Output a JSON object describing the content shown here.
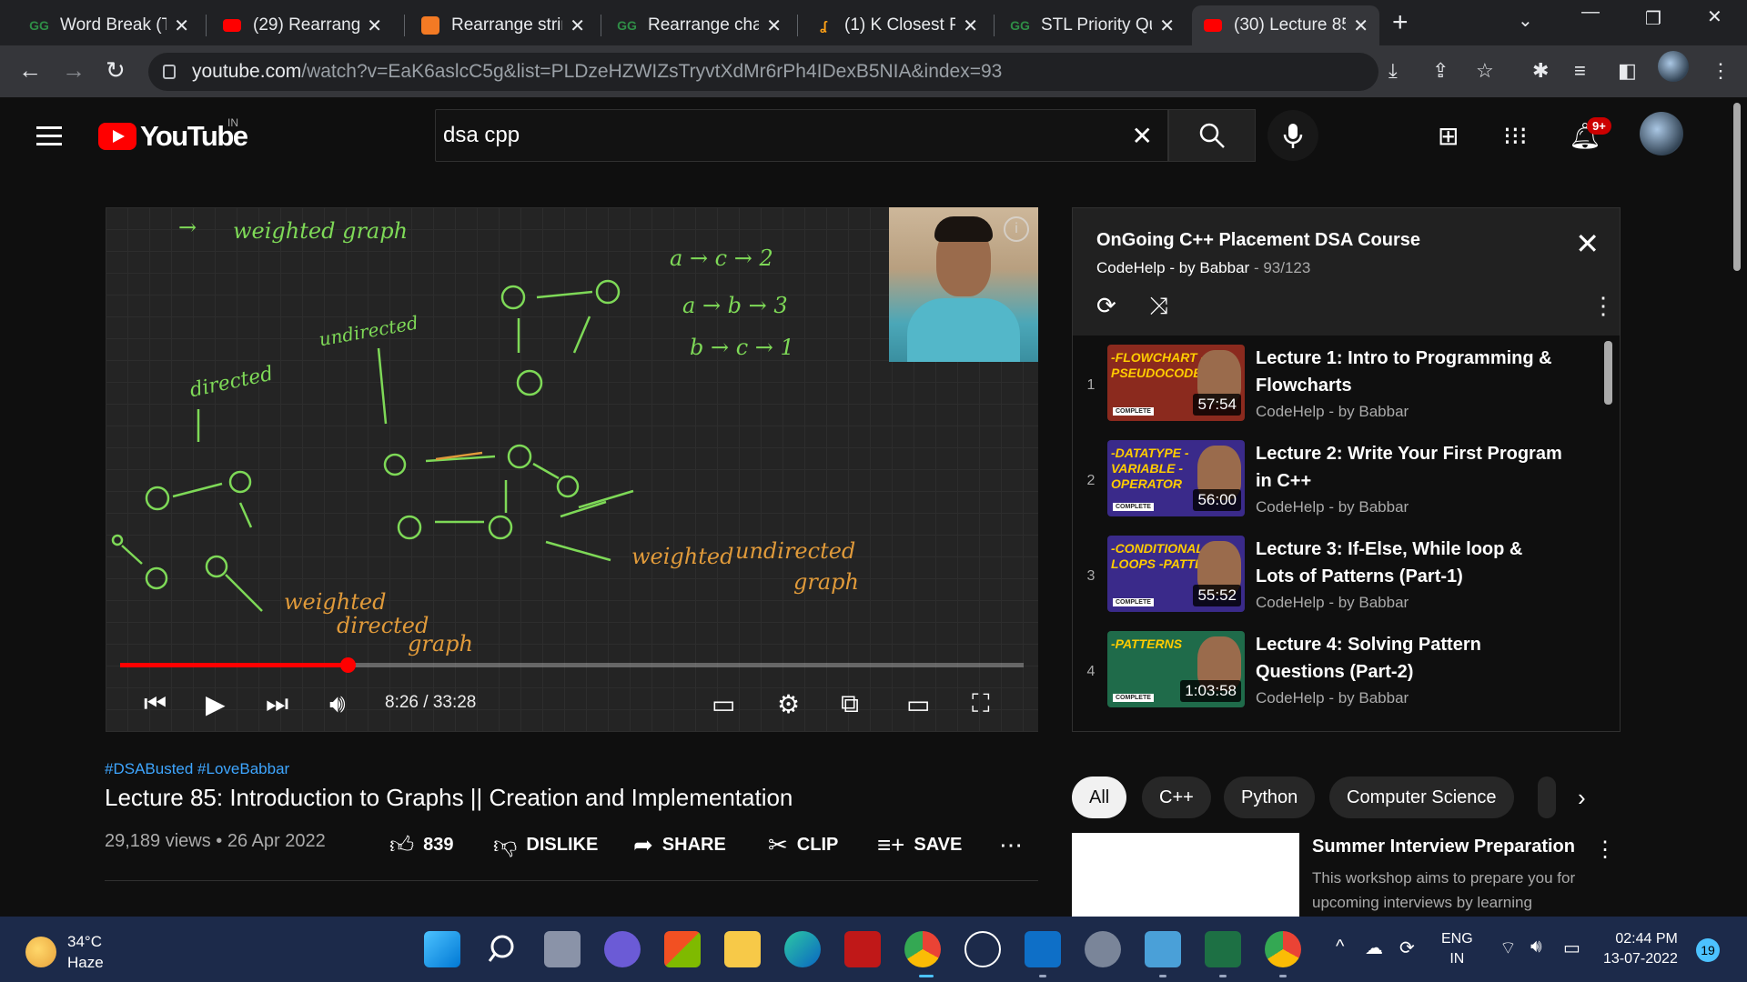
{
  "tabs": [
    {
      "title": "Word Break (Tri",
      "fav": "gfg"
    },
    {
      "title": "(29) Rearrange",
      "fav": "yt"
    },
    {
      "title": "Rearrange strin",
      "fav": "cn"
    },
    {
      "title": "Rearrange char",
      "fav": "gfg"
    },
    {
      "title": "(1) K Closest Pc",
      "fav": "lc"
    },
    {
      "title": "STL Priority Qu",
      "fav": "gfg"
    },
    {
      "title": "(30) Lecture 85",
      "fav": "yt"
    }
  ],
  "url": {
    "host": "youtube.com",
    "path": "/watch?v=EaK6aslcC5g&list=PLDzeHZWIZsTryvtXdMr6rPh4IDexB5NIA&index=93"
  },
  "youtube": {
    "country": "IN",
    "search_value": "dsa cpp",
    "notifications": "9+"
  },
  "video": {
    "current_time": "8:26",
    "duration": "33:28",
    "time_display": "8:26 / 33:28",
    "progress": 0.252,
    "board": {
      "w1": "→",
      "w2": "weighted graph",
      "w3": "directed",
      "w4": "undirected",
      "w5": "a → c → 2",
      "w6": "a → b → 3",
      "w7": "b → c → 1",
      "w8": "weighted",
      "w9": "undirected",
      "w10": "graph",
      "w11": "weighted",
      "w12": "directed",
      "w13": "graph"
    }
  },
  "playlist": {
    "title": "OnGoing C++ Placement DSA Course",
    "channel": "CodeHelp - by Babbar",
    "position": "93/123",
    "items": [
      {
        "index": "1",
        "title": "Lecture 1: Intro to Programming & Flowcharts",
        "channel": "CodeHelp - by Babbar",
        "duration": "57:54",
        "thumb_text": "-FLOWCHART -PSEUDOCODE",
        "thumb_bg": "#8b2a1e"
      },
      {
        "index": "2",
        "title": "Lecture 2: Write Your First Program in C++",
        "channel": "CodeHelp - by Babbar",
        "duration": "56:00",
        "thumb_text": "-DATATYPE -VARIABLE -OPERATOR",
        "thumb_bg": "#3a2a8a"
      },
      {
        "index": "3",
        "title": "Lecture 3: If-Else, While loop & Lots of Patterns (Part-1)",
        "channel": "CodeHelp - by Babbar",
        "duration": "55:52",
        "thumb_text": "-CONDITIONALS -LOOPS -PATTERNS",
        "thumb_bg": "#3a2a8a"
      },
      {
        "index": "4",
        "title": "Lecture 4: Solving Pattern Questions (Part-2)",
        "channel": "CodeHelp - by Babbar",
        "duration": "1:03:58",
        "thumb_text": "-PATTERNS",
        "thumb_bg": "#1f6b4a"
      }
    ]
  },
  "info": {
    "hashtags": "#DSABusted #LoveBabbar",
    "title": "Lecture 85: Introduction to Graphs || Creation and Implementation",
    "meta": "29,189 views • 26 Apr 2022",
    "likes": "839",
    "dislike": "DISLIKE",
    "share": "SHARE",
    "clip": "CLIP",
    "save": "SAVE"
  },
  "chips": [
    "All",
    "C++",
    "Python",
    "Computer Science"
  ],
  "recommended": {
    "title": "Summer Interview Preparation",
    "desc": "This workshop aims to prepare you for upcoming interviews by learning"
  },
  "taskbar": {
    "temp": "34°C",
    "weather": "Haze",
    "lang1": "ENG",
    "lang2": "IN",
    "time": "02:44 PM",
    "date": "13-07-2022",
    "notif_count": "19"
  }
}
